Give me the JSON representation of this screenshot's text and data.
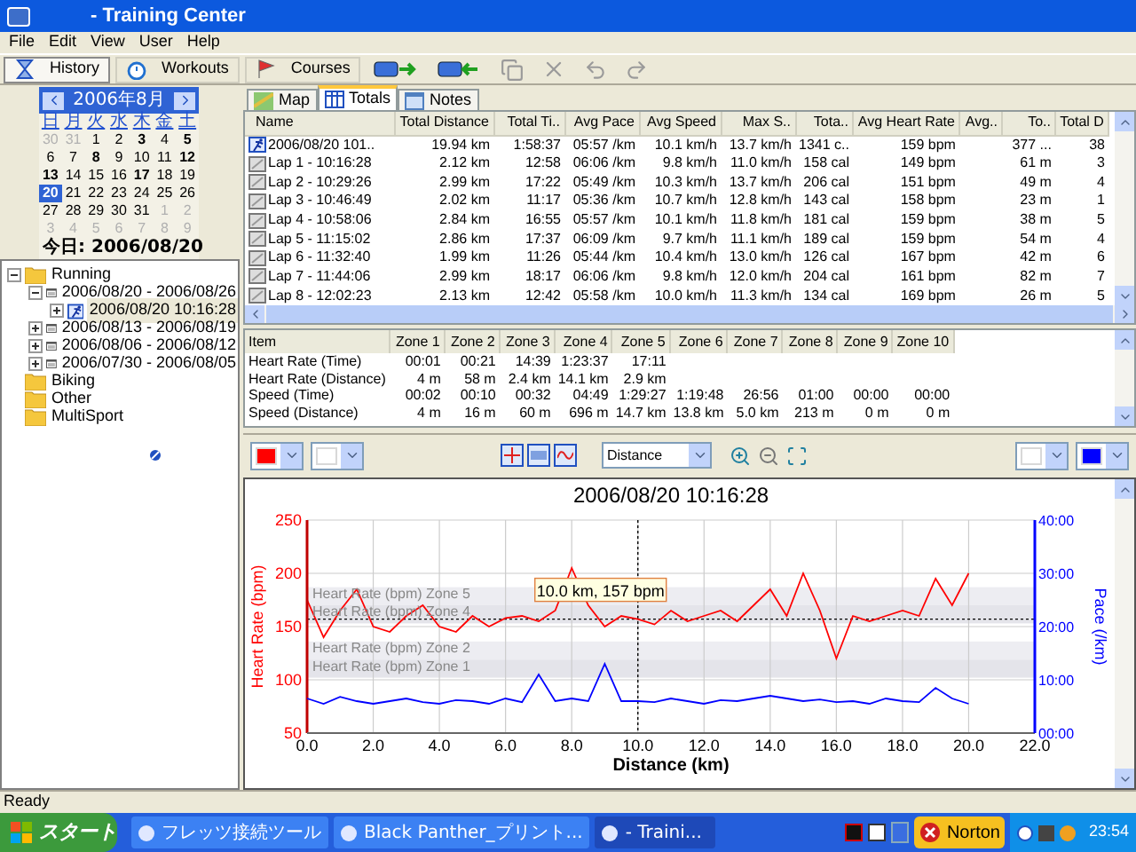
{
  "window": {
    "title": "- Training Center"
  },
  "menu": [
    "File",
    "Edit",
    "View",
    "User",
    "Help"
  ],
  "toolbar": {
    "tabs": [
      {
        "label": "History",
        "selected": true
      },
      {
        "label": "Workouts",
        "selected": false
      },
      {
        "label": "Courses",
        "selected": false
      }
    ],
    "buttons": [
      {
        "kind": "import",
        "disabled": false
      },
      {
        "kind": "export",
        "disabled": false
      },
      {
        "kind": "copy",
        "disabled": true
      },
      {
        "kind": "delete",
        "disabled": true
      },
      {
        "kind": "undo",
        "disabled": true
      },
      {
        "kind": "redo",
        "disabled": true
      }
    ]
  },
  "calendar": {
    "month": "2006年8月",
    "weekdays": [
      "日",
      "月",
      "火",
      "水",
      "木",
      "金",
      "土"
    ],
    "days": [
      {
        "day": "30",
        "kind": "other",
        "selected": false
      },
      {
        "day": "31",
        "kind": "other",
        "selected": false
      },
      {
        "day": "1",
        "kind": "normal",
        "selected": false
      },
      {
        "day": "2",
        "kind": "normal",
        "selected": false
      },
      {
        "day": "3",
        "kind": "bold",
        "selected": false
      },
      {
        "day": "4",
        "kind": "normal",
        "selected": false
      },
      {
        "day": "5",
        "kind": "bold",
        "selected": false
      },
      {
        "day": "6",
        "kind": "normal",
        "selected": false
      },
      {
        "day": "7",
        "kind": "normal",
        "selected": false
      },
      {
        "day": "8",
        "kind": "bold",
        "selected": false
      },
      {
        "day": "9",
        "kind": "normal",
        "selected": false
      },
      {
        "day": "10",
        "kind": "normal",
        "selected": false
      },
      {
        "day": "11",
        "kind": "normal",
        "selected": false
      },
      {
        "day": "12",
        "kind": "bold",
        "selected": false
      },
      {
        "day": "13",
        "kind": "bold",
        "selected": false
      },
      {
        "day": "14",
        "kind": "normal",
        "selected": false
      },
      {
        "day": "15",
        "kind": "normal",
        "selected": false
      },
      {
        "day": "16",
        "kind": "normal",
        "selected": false
      },
      {
        "day": "17",
        "kind": "bold",
        "selected": false
      },
      {
        "day": "18",
        "kind": "normal",
        "selected": false
      },
      {
        "day": "19",
        "kind": "normal",
        "selected": false
      },
      {
        "day": "20",
        "kind": "bold",
        "selected": true
      },
      {
        "day": "21",
        "kind": "normal",
        "selected": false
      },
      {
        "day": "22",
        "kind": "normal",
        "selected": false
      },
      {
        "day": "23",
        "kind": "normal",
        "selected": false
      },
      {
        "day": "24",
        "kind": "normal",
        "selected": false
      },
      {
        "day": "25",
        "kind": "normal",
        "selected": false
      },
      {
        "day": "26",
        "kind": "normal",
        "selected": false
      },
      {
        "day": "27",
        "kind": "normal",
        "selected": false
      },
      {
        "day": "28",
        "kind": "normal",
        "selected": false
      },
      {
        "day": "29",
        "kind": "normal",
        "selected": false
      },
      {
        "day": "30",
        "kind": "normal",
        "selected": false
      },
      {
        "day": "31",
        "kind": "normal",
        "selected": false
      },
      {
        "day": "1",
        "kind": "other",
        "selected": false
      },
      {
        "day": "2",
        "kind": "other",
        "selected": false
      },
      {
        "day": "3",
        "kind": "other",
        "selected": false
      },
      {
        "day": "4",
        "kind": "other",
        "selected": false
      },
      {
        "day": "5",
        "kind": "other",
        "selected": false
      },
      {
        "day": "6",
        "kind": "other",
        "selected": false
      },
      {
        "day": "7",
        "kind": "other",
        "selected": false
      },
      {
        "day": "8",
        "kind": "other",
        "selected": false
      },
      {
        "day": "9",
        "kind": "other",
        "selected": false
      }
    ],
    "today": "今日: 2006/08/20"
  },
  "tree": [
    {
      "label": "Running",
      "kind": "folder",
      "expanded": true,
      "selected": false,
      "children": [
        {
          "label": "2006/08/20 - 2006/08/26",
          "kind": "week",
          "expanded": true,
          "selected": false,
          "children": [
            {
              "label": "2006/08/20 10:16:28",
              "kind": "activity",
              "expanded": false,
              "selected": true
            }
          ]
        },
        {
          "label": "2006/08/13 - 2006/08/19",
          "kind": "week",
          "expanded": false,
          "selected": false
        },
        {
          "label": "2006/08/06 - 2006/08/12",
          "kind": "week",
          "expanded": false,
          "selected": false
        },
        {
          "label": "2006/07/30 - 2006/08/05",
          "kind": "week",
          "expanded": false,
          "selected": false
        }
      ]
    },
    {
      "label": "Biking",
      "kind": "folder",
      "selected": false
    },
    {
      "label": "Other",
      "kind": "folder",
      "selected": false
    },
    {
      "label": "MultiSport",
      "kind": "folder",
      "selected": false
    }
  ],
  "detail_tabs": [
    {
      "label": "Map",
      "kind": "map",
      "selected": false
    },
    {
      "label": "Totals",
      "kind": "totals",
      "selected": true
    },
    {
      "label": "Notes",
      "kind": "notes",
      "selected": false
    }
  ],
  "laps": {
    "columns": [
      "Name",
      "Total Distance",
      "Total Ti..",
      "Avg Pace",
      "Avg Speed",
      "Max S..",
      "Tota..",
      "Avg Heart Rate",
      "Avg..",
      "To..",
      "Total D"
    ],
    "rows": [
      {
        "kind": "activity",
        "cells": [
          "2006/08/20 101..",
          "19.94 km",
          "1:58:37",
          "05:57 /km",
          "10.1 km/h",
          "13.7 km/h",
          "1341 c..",
          "159 bpm",
          "",
          "377 ...",
          "38"
        ]
      },
      {
        "kind": "lap",
        "cells": [
          "Lap 1 - 10:16:28",
          "2.12 km",
          "12:58",
          "06:06 /km",
          "9.8 km/h",
          "11.0 km/h",
          "158 cal",
          "149 bpm",
          "",
          "61 m",
          "3"
        ]
      },
      {
        "kind": "lap",
        "cells": [
          "Lap 2 - 10:29:26",
          "2.99 km",
          "17:22",
          "05:49 /km",
          "10.3 km/h",
          "13.7 km/h",
          "206 cal",
          "151 bpm",
          "",
          "49 m",
          "4"
        ]
      },
      {
        "kind": "lap",
        "cells": [
          "Lap 3 - 10:46:49",
          "2.02 km",
          "11:17",
          "05:36 /km",
          "10.7 km/h",
          "12.8 km/h",
          "143 cal",
          "158 bpm",
          "",
          "23 m",
          "1"
        ]
      },
      {
        "kind": "lap",
        "cells": [
          "Lap 4 - 10:58:06",
          "2.84 km",
          "16:55",
          "05:57 /km",
          "10.1 km/h",
          "11.8 km/h",
          "181 cal",
          "159 bpm",
          "",
          "38 m",
          "5"
        ]
      },
      {
        "kind": "lap",
        "cells": [
          "Lap 5 - 11:15:02",
          "2.86 km",
          "17:37",
          "06:09 /km",
          "9.7 km/h",
          "11.1 km/h",
          "189 cal",
          "159 bpm",
          "",
          "54 m",
          "4"
        ]
      },
      {
        "kind": "lap",
        "cells": [
          "Lap 6 - 11:32:40",
          "1.99 km",
          "11:26",
          "05:44 /km",
          "10.4 km/h",
          "13.0 km/h",
          "126 cal",
          "167 bpm",
          "",
          "42 m",
          "6"
        ]
      },
      {
        "kind": "lap",
        "cells": [
          "Lap 7 - 11:44:06",
          "2.99 km",
          "18:17",
          "06:06 /km",
          "9.8 km/h",
          "12.0 km/h",
          "204 cal",
          "161 bpm",
          "",
          "82 m",
          "7"
        ]
      },
      {
        "kind": "lap",
        "cells": [
          "Lap 8 - 12:02:23",
          "2.13 km",
          "12:42",
          "05:58 /km",
          "10.0 km/h",
          "11.3 km/h",
          "134 cal",
          "169 bpm",
          "",
          "26 m",
          "5"
        ]
      }
    ]
  },
  "zones": {
    "columns": [
      "Item",
      "Zone 1",
      "Zone 2",
      "Zone 3",
      "Zone 4",
      "Zone 5",
      "Zone 6",
      "Zone 7",
      "Zone 8",
      "Zone 9",
      "Zone 10"
    ],
    "rows": [
      [
        "Heart Rate (Time)",
        "00:01",
        "00:21",
        "14:39",
        "1:23:37",
        "17:11",
        "",
        "",
        "",
        "",
        ""
      ],
      [
        "Heart Rate (Distance)",
        "4 m",
        "58 m",
        "2.4 km",
        "14.1 km",
        "2.9 km",
        "",
        "",
        "",
        "",
        ""
      ],
      [
        "Speed (Time)",
        "00:02",
        "00:10",
        "00:32",
        "04:49",
        "1:29:27",
        "1:19:48",
        "26:56",
        "01:00",
        "00:00",
        "00:00"
      ],
      [
        "Speed (Distance)",
        "4 m",
        "16 m",
        "60 m",
        "696 m",
        "14.7 km",
        "13.8 km",
        "5.0 km",
        "213 m",
        "0 m",
        "0 m"
      ]
    ]
  },
  "chart_toolbar": {
    "left_dropdowns": [
      {
        "color": "#ff0000"
      },
      {
        "color": "#ffffff"
      }
    ],
    "axis": "Distance",
    "right_dropdowns": [
      {
        "color": "#ffffff"
      },
      {
        "color": "#0000ff"
      }
    ]
  },
  "chart": {
    "chart_data": {
      "type": "line",
      "title": "2006/08/20 10:16:28",
      "xlabel": "Distance (km)",
      "ylabel": "Heart Rate (bpm)",
      "x": [
        0,
        0.5,
        1,
        1.5,
        2,
        2.5,
        3,
        3.5,
        4,
        4.5,
        5,
        5.5,
        6,
        6.5,
        7,
        7.5,
        8,
        8.5,
        9,
        9.5,
        10,
        10.5,
        11,
        11.5,
        12,
        12.5,
        13,
        13.5,
        14,
        14.5,
        15,
        15.5,
        16,
        16.5,
        17,
        17.5,
        18,
        18.5,
        19,
        19.5,
        20
      ],
      "series": [
        {
          "color": "#ff0000",
          "values": [
            175,
            140,
            165,
            185,
            150,
            145,
            160,
            170,
            150,
            145,
            160,
            150,
            158,
            160,
            155,
            165,
            205,
            170,
            150,
            160,
            157,
            152,
            165,
            155,
            160,
            165,
            155,
            170,
            185,
            160,
            200,
            165,
            120,
            160,
            155,
            160,
            165,
            160,
            195,
            170,
            200
          ]
        }
      ],
      "xlim": [
        0,
        22
      ],
      "ylim": [
        50,
        250
      ],
      "xticks": [
        {
          "value": 0,
          "label": "0.0"
        },
        {
          "value": 2,
          "label": "2.0"
        },
        {
          "value": 4,
          "label": "4.0"
        },
        {
          "value": 6,
          "label": "6.0"
        },
        {
          "value": 8,
          "label": "8.0"
        },
        {
          "value": 10,
          "label": "10.0"
        },
        {
          "value": 12,
          "label": "12.0"
        },
        {
          "value": 14,
          "label": "14.0"
        },
        {
          "value": 16,
          "label": "16.0"
        },
        {
          "value": 18,
          "label": "18.0"
        },
        {
          "value": 20,
          "label": "20.0"
        },
        {
          "value": 22,
          "label": "22.0"
        }
      ],
      "yticks": [
        50,
        100,
        150,
        200,
        250
      ],
      "grid": true,
      "annotations": [
        {
          "text": "10.0 km, 157 bpm",
          "x": 10,
          "y": 157
        }
      ]
    },
    "zone_labels": [
      "Heart Rate (bpm) Zone 5",
      "Heart Rate (bpm) Zone 4",
      "Heart Rate (bpm) Zone 2",
      "Heart Rate (bpm) Zone 1"
    ],
    "pace_chart": {
      "chart_data": {
        "type": "line",
        "ylabel": "Pace (/km)",
        "x": [
          0,
          0.5,
          1,
          1.5,
          2,
          2.5,
          3,
          3.5,
          4,
          4.5,
          5,
          5.5,
          6,
          6.5,
          7,
          7.5,
          8,
          8.5,
          9,
          9.5,
          10,
          10.5,
          11,
          11.5,
          12,
          12.5,
          13,
          13.5,
          14,
          14.5,
          15,
          15.5,
          16,
          16.5,
          17,
          17.5,
          18,
          18.5,
          19,
          19.5,
          20
        ],
        "series": [
          {
            "color": "#0000ff",
            "values": [
              6.5,
              5.5,
              6.8,
              6,
              5.5,
              6,
              6.5,
              5.8,
              5.5,
              6.2,
              6,
              5.5,
              6.5,
              5.8,
              11,
              6,
              6.5,
              6,
              13,
              6,
              6,
              5.8,
              6.5,
              6,
              5.5,
              6.2,
              6,
              6.5,
              7,
              6.5,
              6,
              6.3,
              5.8,
              6,
              5.5,
              6.5,
              6,
              5.8,
              8.5,
              6.5,
              5.5
            ]
          }
        ],
        "xlim": [
          0,
          22
        ],
        "ylim": [
          0,
          40
        ],
        "yticks": [
          {
            "value": 0,
            "label": "00:00"
          },
          {
            "value": 10,
            "label": "10:00"
          },
          {
            "value": 20,
            "label": "20:00"
          },
          {
            "value": 30,
            "label": "30:00"
          },
          {
            "value": 40,
            "label": "40:00"
          }
        ]
      }
    }
  },
  "status_bar": "Ready",
  "taskbar": {
    "start": "スタート",
    "tasks": [
      {
        "label": "フレッツ接続ツール",
        "active": false
      },
      {
        "label": "Black Panther_プリント...",
        "active": false
      },
      {
        "label": "- Traini...",
        "active": true
      }
    ],
    "norton": "Norton",
    "clock": "23:54"
  }
}
